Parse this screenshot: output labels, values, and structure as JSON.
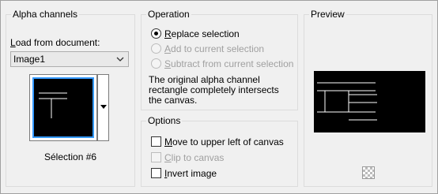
{
  "alpha_channels": {
    "title": "Alpha channels",
    "load_label": "Load from document:",
    "document_select": {
      "value": "Image1"
    },
    "thumbnail_caption": "Sélection #6"
  },
  "operation": {
    "title": "Operation",
    "options": [
      {
        "label": "Replace selection",
        "checked": true,
        "enabled": true
      },
      {
        "label": "Add to current selection",
        "checked": false,
        "enabled": false
      },
      {
        "label": "Subtract from current selection",
        "checked": false,
        "enabled": false
      }
    ],
    "info_text": "The original alpha channel rectangle completely intersects the canvas."
  },
  "options": {
    "title": "Options",
    "items": [
      {
        "label": "Move to upper left of canvas",
        "checked": false,
        "enabled": true
      },
      {
        "label": "Clip to canvas",
        "checked": false,
        "enabled": false
      },
      {
        "label": "Invert image",
        "checked": false,
        "enabled": true
      }
    ]
  },
  "preview": {
    "title": "Preview"
  },
  "colors": {
    "selection_border": "#3399ff",
    "preview_bg": "#000000"
  }
}
